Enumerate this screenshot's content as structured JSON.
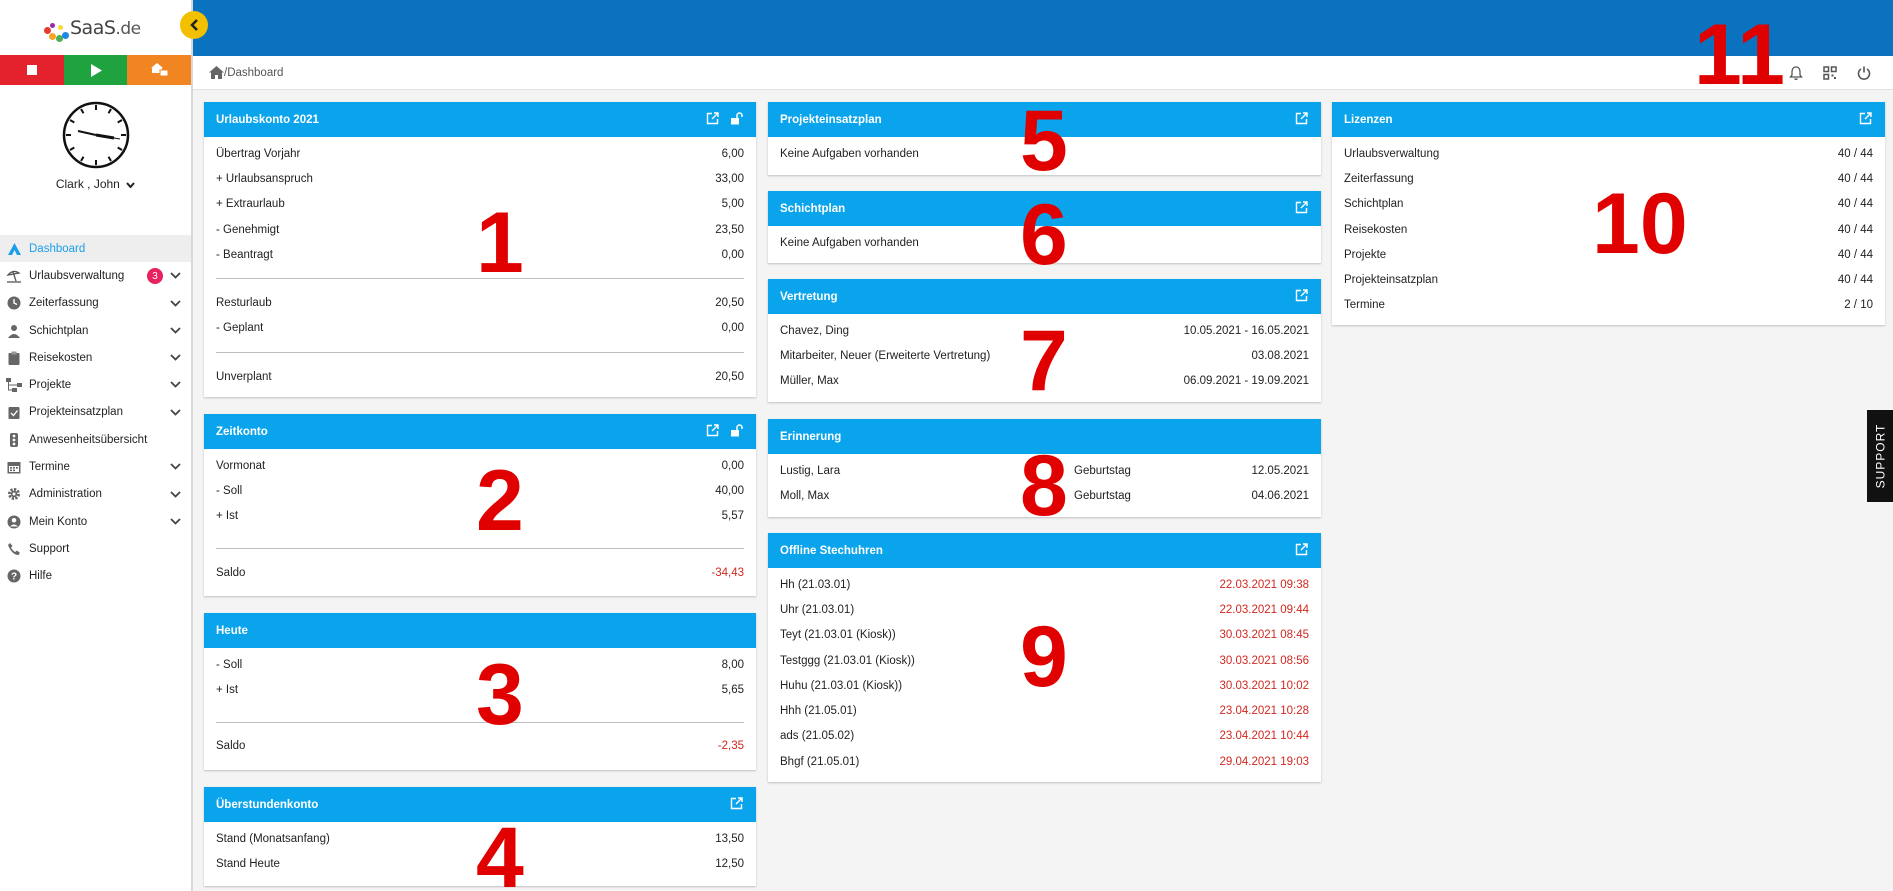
{
  "logo": {
    "brand": "SaaS",
    "tld": ".de"
  },
  "user": {
    "name": "Clark , John"
  },
  "nav": [
    {
      "label": "Dashboard",
      "icon": "dashboard-icon",
      "active": true
    },
    {
      "label": "Urlaubsverwaltung",
      "icon": "beach-icon",
      "badge": "3",
      "expandable": true
    },
    {
      "label": "Zeiterfassung",
      "icon": "clock-icon",
      "expandable": true
    },
    {
      "label": "Schichtplan",
      "icon": "person-icon",
      "expandable": true
    },
    {
      "label": "Reisekosten",
      "icon": "clipboard-icon",
      "expandable": true
    },
    {
      "label": "Projekte",
      "icon": "project-icon",
      "expandable": true
    },
    {
      "label": "Projekteinsatzplan",
      "icon": "clipboard-check-icon",
      "expandable": true
    },
    {
      "label": "Anwesenheitsübersicht",
      "icon": "traffic-light-icon"
    },
    {
      "label": "Termine",
      "icon": "calendar-icon",
      "expandable": true
    },
    {
      "label": "Administration",
      "icon": "gear-icon",
      "expandable": true
    },
    {
      "label": "Mein Konto",
      "icon": "account-icon",
      "expandable": true
    },
    {
      "label": "Support",
      "icon": "phone-icon"
    },
    {
      "label": "Hilfe",
      "icon": "help-icon"
    }
  ],
  "breadcrumb": {
    "text": "/Dashboard"
  },
  "support_label": "SUPPORT",
  "urlaubskonto": {
    "title": "Urlaubskonto 2021",
    "rows1": [
      {
        "label": "Übertrag Vorjahr",
        "value": "6,00"
      },
      {
        "label": "+ Urlaubsanspruch",
        "value": "33,00"
      },
      {
        "label": "+ Extraurlaub",
        "value": "5,00"
      },
      {
        "label": "- Genehmigt",
        "value": "23,50"
      },
      {
        "label": "- Beantragt",
        "value": "0,00"
      }
    ],
    "rows2": [
      {
        "label": "Resturlaub",
        "value": "20,50"
      },
      {
        "label": "- Geplant",
        "value": "0,00"
      }
    ],
    "rows3": [
      {
        "label": "Unverplant",
        "value": "20,50"
      }
    ]
  },
  "zeitkonto": {
    "title": "Zeitkonto",
    "rows1": [
      {
        "label": "Vormonat",
        "value": "0,00"
      },
      {
        "label": "- Soll",
        "value": "40,00"
      },
      {
        "label": "+ Ist",
        "value": "5,57"
      }
    ],
    "saldo_label": "Saldo",
    "saldo_value": "-34,43"
  },
  "heute": {
    "title": "Heute",
    "rows1": [
      {
        "label": "- Soll",
        "value": "8,00"
      },
      {
        "label": "+ Ist",
        "value": "5,65"
      }
    ],
    "saldo_label": "Saldo",
    "saldo_value": "-2,35"
  },
  "ueberstunden": {
    "title": "Überstundenkonto",
    "rows": [
      {
        "label": "Stand (Monatsanfang)",
        "value": "13,50"
      },
      {
        "label": "Stand Heute",
        "value": "12,50"
      }
    ]
  },
  "projekteinsatzplan": {
    "title": "Projekteinsatzplan",
    "empty": "Keine Aufgaben vorhanden"
  },
  "schichtplan": {
    "title": "Schichtplan",
    "empty": "Keine Aufgaben vorhanden"
  },
  "vertretung": {
    "title": "Vertretung",
    "rows": [
      {
        "label": "Chavez, Ding",
        "value": "10.05.2021 - 16.05.2021"
      },
      {
        "label": "Mitarbeiter, Neuer (Erweiterte Vertretung)",
        "value": "03.08.2021"
      },
      {
        "label": "Müller, Max",
        "value": "06.09.2021 - 19.09.2021"
      }
    ]
  },
  "erinnerung": {
    "title": "Erinnerung",
    "rows": [
      {
        "name": "Lustig, Lara",
        "type": "Geburtstag",
        "date": "12.05.2021"
      },
      {
        "name": "Moll, Max",
        "type": "Geburtstag",
        "date": "04.06.2021"
      }
    ]
  },
  "offline": {
    "title": "Offline Stechuhren",
    "rows": [
      {
        "label": "Hh (21.03.01)",
        "value": "22.03.2021 09:38"
      },
      {
        "label": "Uhr (21.03.01)",
        "value": "22.03.2021 09:44"
      },
      {
        "label": "Teyt (21.03.01 (Kiosk))",
        "value": "30.03.2021 08:45"
      },
      {
        "label": "Testggg (21.03.01 (Kiosk))",
        "value": "30.03.2021 08:56"
      },
      {
        "label": "Huhu (21.03.01 (Kiosk))",
        "value": "30.03.2021 10:02"
      },
      {
        "label": "Hhh (21.05.01)",
        "value": "23.04.2021 10:28"
      },
      {
        "label": "ads (21.05.02)",
        "value": "23.04.2021 10:44"
      },
      {
        "label": "Bhgf (21.05.01)",
        "value": "29.04.2021 19:03"
      }
    ]
  },
  "lizenzen": {
    "title": "Lizenzen",
    "rows": [
      {
        "label": "Urlaubsverwaltung",
        "value": "40 / 44"
      },
      {
        "label": "Zeiterfassung",
        "value": "40 / 44"
      },
      {
        "label": "Schichtplan",
        "value": "40 / 44"
      },
      {
        "label": "Reisekosten",
        "value": "40 / 44"
      },
      {
        "label": "Projekte",
        "value": "40 / 44"
      },
      {
        "label": "Projekteinsatzplan",
        "value": "40 / 44"
      },
      {
        "label": "Termine",
        "value": "2 / 10"
      }
    ]
  },
  "annotations": [
    "1",
    "2",
    "3",
    "4",
    "5",
    "6",
    "7",
    "8",
    "9",
    "10",
    "11"
  ],
  "colors": {
    "header": "#0a72bf",
    "card_header": "#0aa4ec",
    "accent": "#1a9fe8",
    "negative": "#d0281f",
    "annotation": "#e10000"
  }
}
